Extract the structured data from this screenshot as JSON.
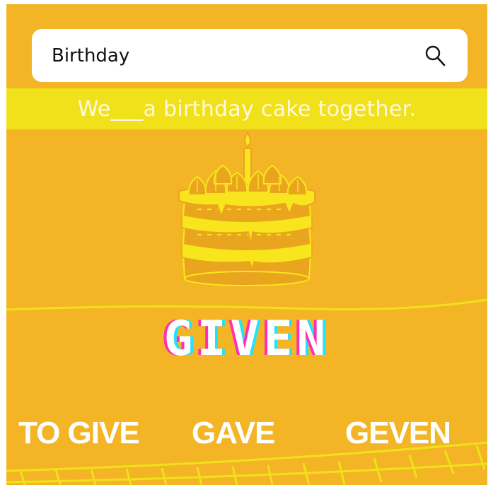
{
  "search": {
    "value": "Birthday",
    "icon": "search-icon"
  },
  "prompt": {
    "sentence": "We___a birthday cake together."
  },
  "answer": {
    "word": "GIVEN"
  },
  "options": [
    {
      "label": "TO GIVE"
    },
    {
      "label": "GAVE"
    },
    {
      "label": "GEVEN"
    }
  ],
  "colors": {
    "background": "#f3b526",
    "band": "#f0e11a",
    "cake_yellow": "#f8e51d",
    "cake_dark": "#e9a51e",
    "accent_pink": "#ff2fb3",
    "accent_cyan": "#21e3ff"
  },
  "illustration": {
    "icon": "birthday-cake-icon"
  }
}
